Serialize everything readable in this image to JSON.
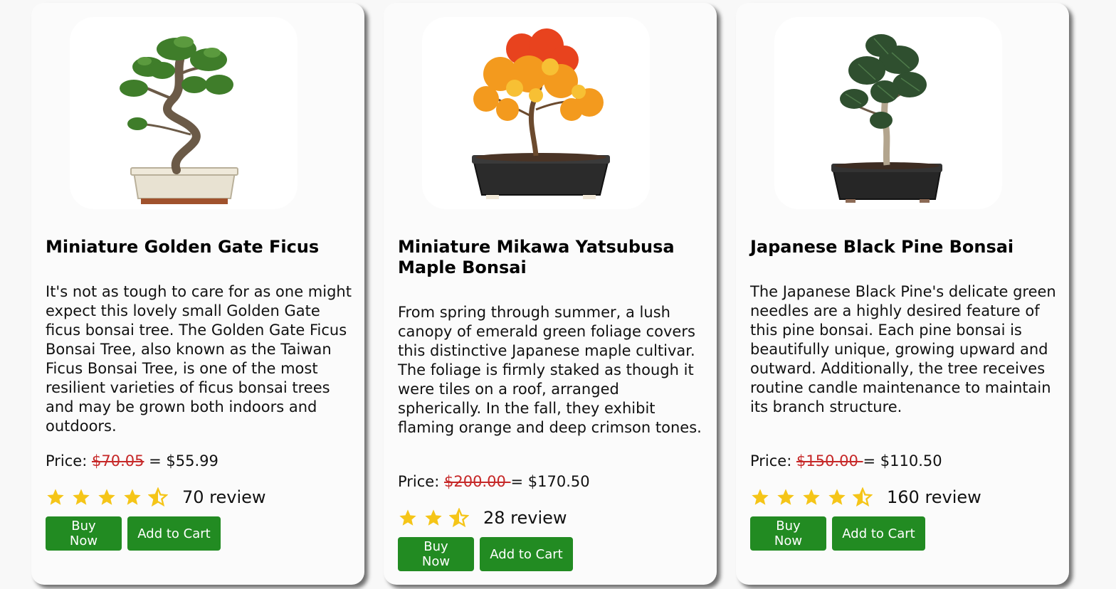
{
  "products": [
    {
      "title": "Miniature Golden Gate Ficus",
      "description": "It's not as tough to care for as one might expect this lovely small Golden Gate ficus bonsai tree. The Golden Gate Ficus Bonsai Tree, also known as the Taiwan Ficus Bonsai Tree, is one of the most resilient varieties of ficus bonsai trees and may be grown both indoors and outdoors.",
      "price_label": "Price: ",
      "old_price": "$70.05",
      "equals": " = ",
      "new_price": "$55.99",
      "rating": 4.5,
      "review_text": "70 review",
      "buy_label": "Buy Now",
      "cart_label": "Add to Cart"
    },
    {
      "title": "Miniature Mikawa Yatsubusa Maple Bonsai",
      "description": "From spring through summer, a lush canopy of emerald green foliage covers this distinctive Japanese maple cultivar. The foliage is firmly staked as though it were tiles on a roof, arranged spherically. In the fall, they exhibit flaming orange and deep crimson tones.",
      "price_label": "Price: ",
      "old_price": "$200.00 ",
      "equals": "= ",
      "new_price": "$170.50",
      "rating": 2.5,
      "review_text": "28 review",
      "buy_label": "Buy Now",
      "cart_label": "Add to Cart"
    },
    {
      "title": "Japanese Black Pine Bonsai",
      "description": "The Japanese Black Pine's delicate green needles are a highly desired feature of this pine bonsai. Each pine bonsai is beautifully unique, growing upward and outward. Additionally, the tree receives routine candle maintenance to maintain its branch structure.",
      "price_label": "Price: ",
      "old_price": "$150.00 ",
      "equals": "= ",
      "new_price": "$110.50",
      "rating": 4.5,
      "review_text": "160 review",
      "buy_label": "Buy Now",
      "cart_label": "Add to Cart"
    }
  ],
  "colors": {
    "button": "#228b22",
    "star": "#f5c518",
    "old_price": "#c62828"
  }
}
